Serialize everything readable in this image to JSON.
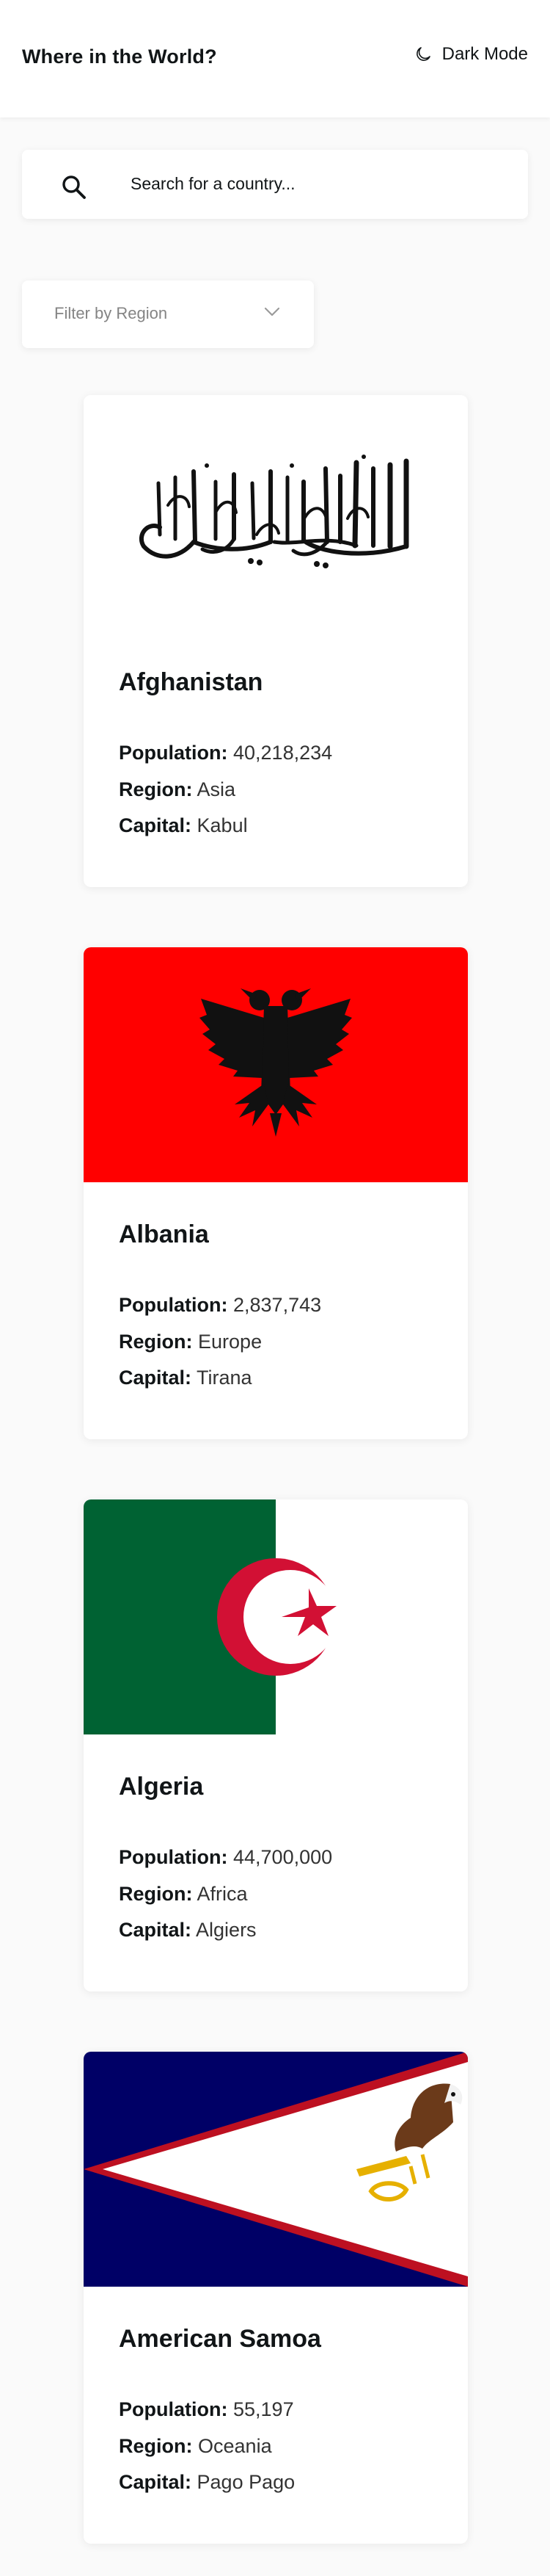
{
  "header": {
    "title": "Where in the World?",
    "theme_toggle": "Dark Mode"
  },
  "search": {
    "placeholder": "Search for a country..."
  },
  "filter": {
    "selected": "Filter by Region"
  },
  "labels": {
    "population": "Population:",
    "region": "Region:",
    "capital": "Capital:"
  },
  "countries": [
    {
      "name": "Afghanistan",
      "population": "40,218,234",
      "region": "Asia",
      "capital": "Kabul",
      "flag_icon": "afghanistan-flag-shahada"
    },
    {
      "name": "Albania",
      "population": "2,837,743",
      "region": "Europe",
      "capital": "Tirana",
      "flag_icon": "albania-flag"
    },
    {
      "name": "Algeria",
      "population": "44,700,000",
      "region": "Africa",
      "capital": "Algiers",
      "flag_icon": "algeria-flag"
    },
    {
      "name": "American Samoa",
      "population": "55,197",
      "region": "Oceania",
      "capital": "Pago Pago",
      "flag_icon": "american-samoa-flag"
    }
  ],
  "colors": {
    "background": "#fafafa",
    "card": "#ffffff",
    "text": "#111517",
    "placeholder_muted": "#848484",
    "albania_red": "#ff0000",
    "algeria_green": "#006233",
    "algeria_red": "#d21034",
    "samoa_blue": "#000066",
    "samoa_red": "#bd1021"
  }
}
